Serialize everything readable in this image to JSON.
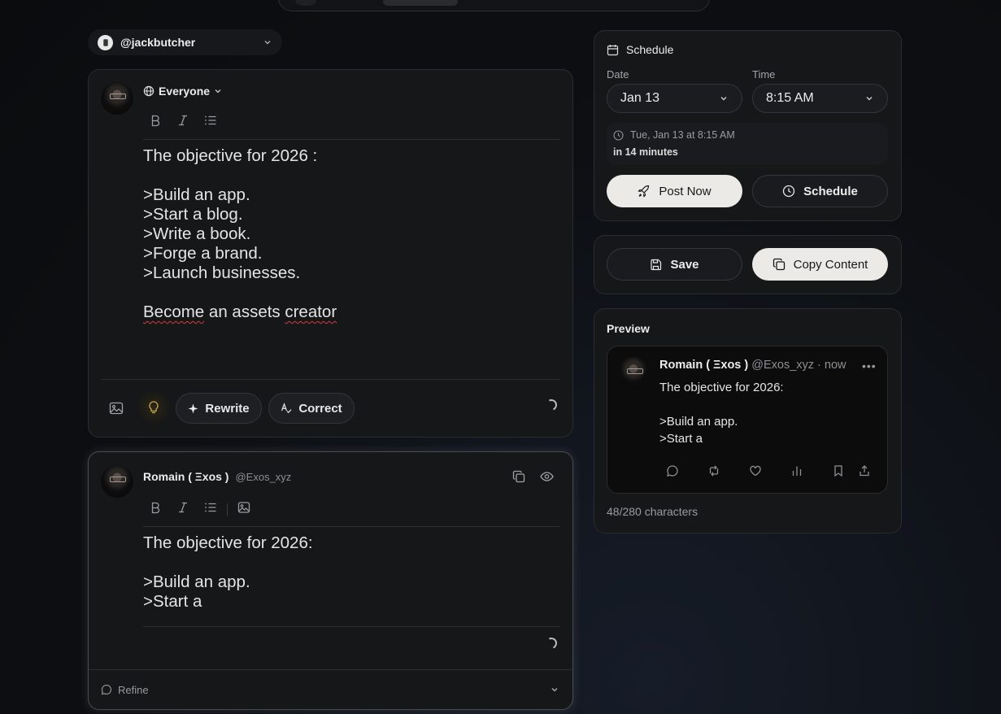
{
  "account": {
    "handle": "@jackbutcher"
  },
  "composer": {
    "audience": "Everyone",
    "lines": [
      "The objective for 2026 :",
      "",
      ">Build an app.",
      ">Start a blog.",
      ">Write a book.",
      ">Forge a brand.",
      ">Launch businesses.",
      ""
    ],
    "last_line_parts": [
      "Become",
      " an assets ",
      "creator"
    ],
    "actions": {
      "rewrite": "Rewrite",
      "correct": "Correct"
    }
  },
  "thread_post": {
    "author_name": "Romain ( Ξxos )",
    "author_handle": "@Exos_xyz",
    "lines": [
      "The objective for 2026:",
      "",
      ">Build an app.",
      ">Start a"
    ],
    "refine_label": "Refine"
  },
  "schedule": {
    "title": "Schedule",
    "date_label": "Date",
    "date_value": "Jan 13",
    "time_label": "Time",
    "time_value": "8:15 AM",
    "summary": "Tue, Jan 13 at 8:15 AM",
    "relative": "in 14 minutes",
    "post_now": "Post Now",
    "schedule_button": "Schedule"
  },
  "save_panel": {
    "save": "Save",
    "copy": "Copy Content"
  },
  "preview": {
    "title": "Preview",
    "name": "Romain ( Ξxos )",
    "handle_time": "@Exos_xyz · now",
    "lines": [
      "The objective for 2026:",
      "",
      ">Build an app.",
      ">Start a"
    ],
    "char_count": "48/280 characters"
  }
}
